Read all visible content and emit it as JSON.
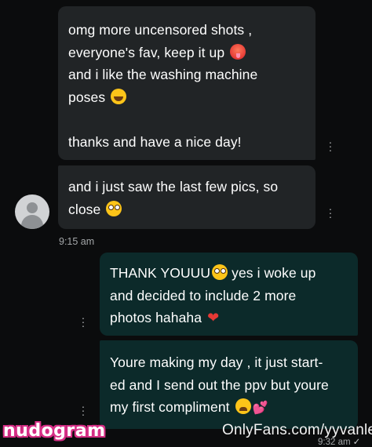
{
  "messages": [
    {
      "direction": "incoming",
      "text_a": "omg more uncensored shots ,\neveryone's fav, keep it up ",
      "emoji_a": "hot-face-emoji",
      "text_b": "\nand i like the washing machine\nposes ",
      "emoji_b": "tears-of-joy-emoji",
      "text_c": "\n\nthanks and have a nice day!"
    },
    {
      "direction": "incoming",
      "text_a": "and i just saw the last few pics, so\nclose ",
      "emoji_a": "flushed-face-emoji",
      "timestamp": "9:15 am"
    },
    {
      "direction": "outgoing",
      "text_a": "THANK YOUUU",
      "emoji_a": "flushed-face-emoji",
      "text_b": " yes i woke up\nand decided to include 2 more\nphotos hahaha ",
      "emoji_b": "red-heart-emoji",
      "heart_glyph": "❤"
    },
    {
      "direction": "outgoing",
      "text_a": "Youre making my day , it just start-\ned and I send out the ppv but youre\nmy first compliment ",
      "emoji_a": "tired-face-emoji",
      "emoji_b": "two-hearts-emoji",
      "hearts_glyph": "💕",
      "timestamp": "9:32 am"
    }
  ],
  "watermark": "OnlyFans.com/yyvanle",
  "brand_logo": "nudogram",
  "colors": {
    "background": "#0b0c0d",
    "incoming_bubble": "#212426",
    "outgoing_bubble": "#0c2a2a",
    "brand_pink": "#d62f86"
  }
}
